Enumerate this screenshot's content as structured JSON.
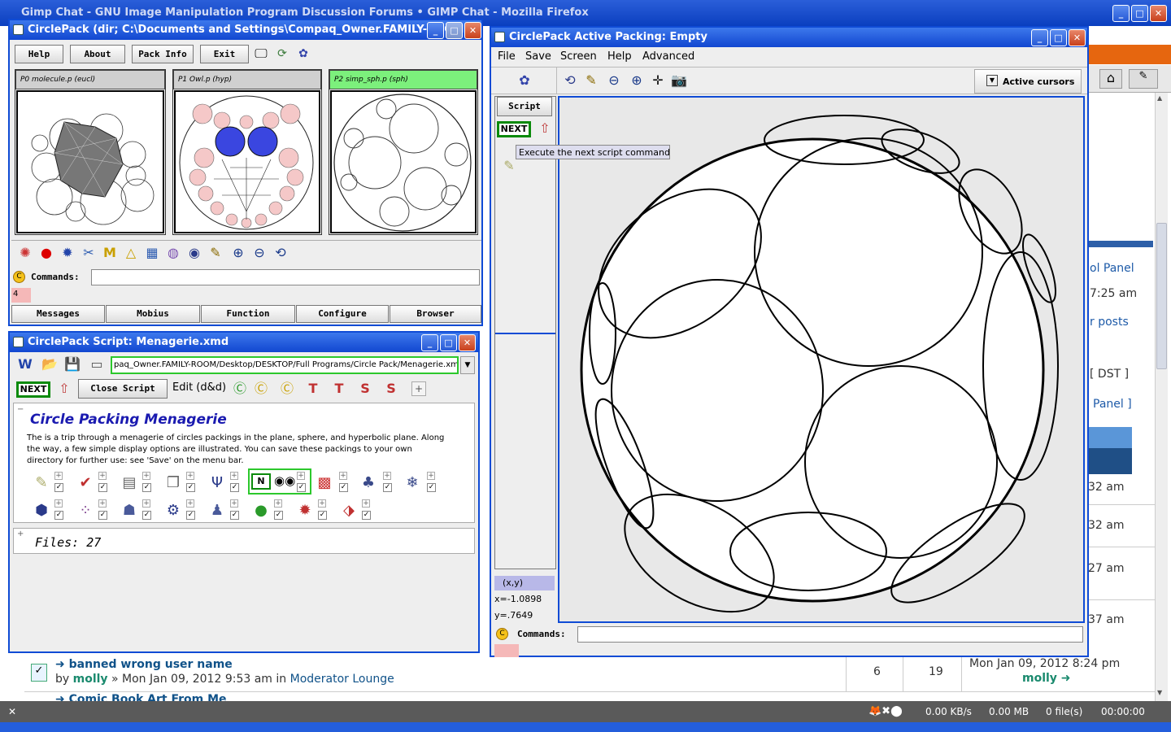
{
  "firefox": {
    "title": "Gimp Chat - GNU Image Manipulation Program Discussion Forums • GIMP Chat - Mozilla Firefox",
    "right_fragments": [
      "ol Panel",
      "7:25 am",
      "r posts",
      "[ DST ]",
      "Panel ]",
      "32 am",
      "32 am",
      "27 am",
      "37 am"
    ],
    "topic1": {
      "title": "banned wrong user name",
      "by": "by",
      "author": "molly",
      "meta": "» Mon Jan 09, 2012 9:53 am in",
      "forum": "Moderator Lounge",
      "replies": "6",
      "views": "19",
      "last_date": "Mon Jan 09, 2012 8:24 pm",
      "last_author": "molly"
    },
    "topic2": {
      "title": "Comic Book Art From Me"
    },
    "status": {
      "speed": "0.00 KB/s",
      "size": "0.00 MB",
      "files": "0 file(s)",
      "time": "00:00:00"
    }
  },
  "main_win": {
    "title": "CirclePack (dir; C:\\Documents and Settings\\Compaq_Owner.FAMILY-ROOM)",
    "buttons": [
      "Help",
      "About",
      "Pack Info",
      "Exit"
    ],
    "panels": [
      {
        "label": "P0 molecule.p (eucl)",
        "active": false
      },
      {
        "label": "P1 Owl.p (hyp)",
        "active": false
      },
      {
        "label": "P2 simp_sph.p (sph)",
        "active": true
      }
    ],
    "commands_label": "Commands:",
    "commands_value": "",
    "history": "4",
    "tabs": [
      "Messages",
      "Mobius",
      "Function",
      "Configure",
      "Browser"
    ]
  },
  "script_win": {
    "title": "CirclePack Script: Menagerie.xmd",
    "path": "paq_Owner.FAMILY-ROOM/Desktop/DESKTOP/Full Programs/Circle Pack/Menagerie.xmd",
    "next": "NEXT",
    "close": "Close Script",
    "edit": "Edit (d&d)",
    "heading": "Circle Packing Menagerie",
    "description": "The is a trip through a menagerie of circles packings in the plane, sphere, and hyperbolic plane. Along the way, a few simple display options are illustrated. You can save these packings to your own directory for further use: see 'Save' on the menu bar.",
    "files": "Files: 27"
  },
  "active_win": {
    "title": "CirclePack Active Packing: Empty",
    "menu": [
      "File",
      "Save",
      "Screen",
      "Help",
      "Advanced"
    ],
    "cursors": "Active cursors",
    "script_btn": "Script",
    "next": "NEXT",
    "tooltip": "Execute the next script command",
    "xy_label": "(x,y)",
    "x": "x=-1.0898",
    "y": "y=.7649",
    "commands_label": "Commands:",
    "commands_value": ""
  },
  "colors": {
    "xp_blue": "#0f4bd5",
    "active_tab": "#7cf07c",
    "next_border": "#0a8a0a",
    "hyp_blue": "#3a46e0",
    "pink": "#f5c8c8"
  }
}
